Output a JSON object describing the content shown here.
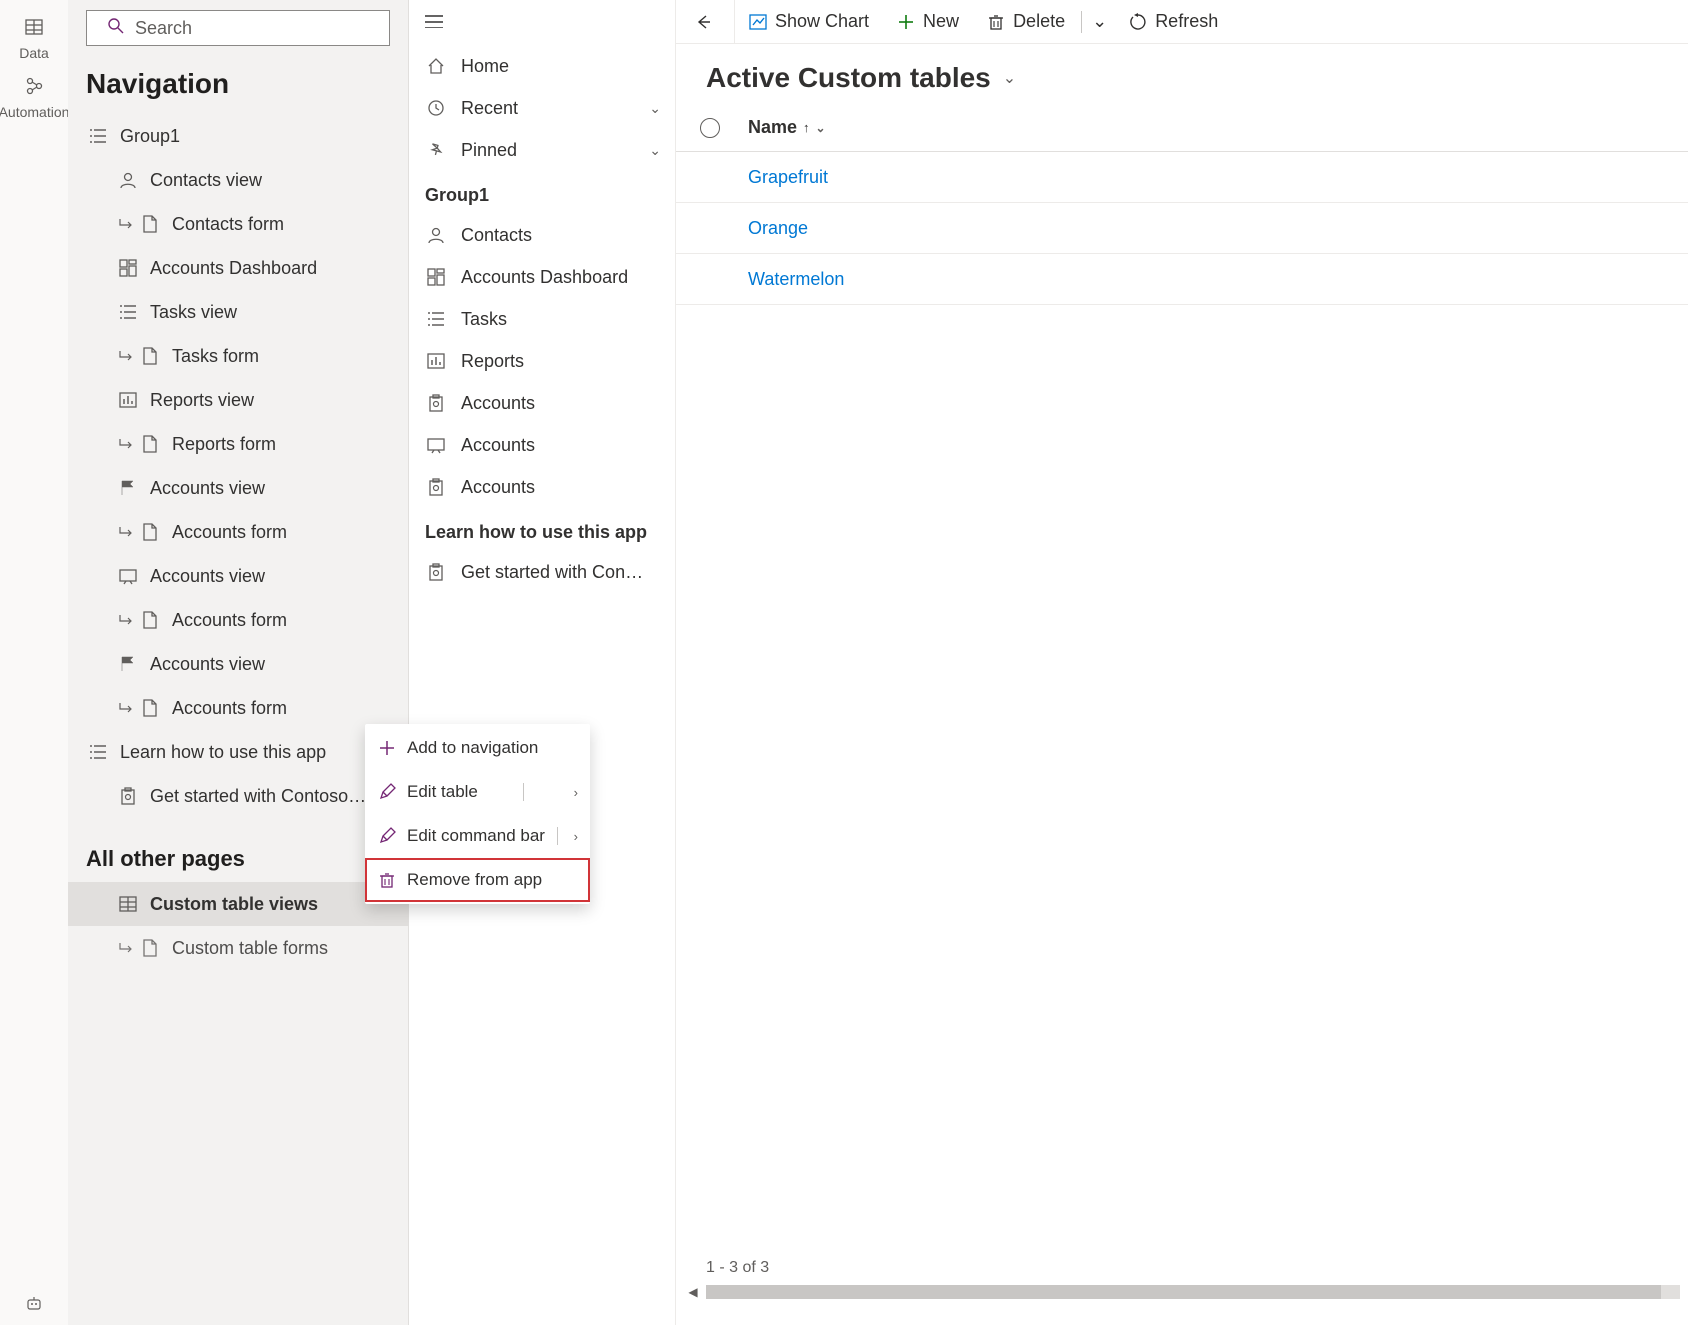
{
  "leftRail": {
    "data": {
      "label": "Data"
    },
    "automation": {
      "label": "Automation"
    }
  },
  "navPanel": {
    "search_placeholder": "Search",
    "title": "Navigation",
    "group_label": "Group1",
    "items": [
      {
        "label": "Contacts view",
        "icon": "person"
      },
      {
        "label": "Contacts form",
        "icon": "form",
        "sub": true
      },
      {
        "label": "Accounts Dashboard",
        "icon": "dashboard"
      },
      {
        "label": "Tasks view",
        "icon": "list"
      },
      {
        "label": "Tasks form",
        "icon": "form",
        "sub": true
      },
      {
        "label": "Reports view",
        "icon": "chart"
      },
      {
        "label": "Reports form",
        "icon": "form",
        "sub": true
      },
      {
        "label": "Accounts view",
        "icon": "flag-red"
      },
      {
        "label": "Accounts form",
        "icon": "form",
        "sub": true
      },
      {
        "label": "Accounts view",
        "icon": "slide"
      },
      {
        "label": "Accounts form",
        "icon": "form",
        "sub": true
      },
      {
        "label": "Accounts view",
        "icon": "flag-red"
      },
      {
        "label": "Accounts form",
        "icon": "form",
        "sub": true
      }
    ],
    "learn_label": "Learn how to use this app",
    "learn_items": [
      {
        "label": "Get started with Contoso…",
        "icon": "clipboard"
      }
    ],
    "other_header": "All other pages",
    "other_items": [
      {
        "label": "Custom table views",
        "icon": "table",
        "selected": true
      },
      {
        "label": "Custom table forms",
        "icon": "form",
        "sub": true
      }
    ]
  },
  "sidebar": {
    "home": "Home",
    "recent": "Recent",
    "pinned": "Pinned",
    "group_header": "Group1",
    "items": [
      {
        "label": "Contacts",
        "icon": "person"
      },
      {
        "label": "Accounts Dashboard",
        "icon": "dashboard"
      },
      {
        "label": "Tasks",
        "icon": "list"
      },
      {
        "label": "Reports",
        "icon": "chart"
      },
      {
        "label": "Accounts",
        "icon": "clipboard"
      },
      {
        "label": "Accounts",
        "icon": "slide"
      },
      {
        "label": "Accounts",
        "icon": "clipboard"
      }
    ],
    "learn_header": "Learn how to use this app",
    "learn_items": [
      {
        "label": "Get started with Con…",
        "icon": "clipboard"
      }
    ]
  },
  "commandBar": {
    "show_chart": "Show Chart",
    "new": "New",
    "delete": "Delete",
    "refresh": "Refresh"
  },
  "main": {
    "view_title": "Active Custom tables",
    "column_name": "Name",
    "rows": [
      "Grapefruit",
      "Orange",
      "Watermelon"
    ],
    "footer": "1 - 3 of 3"
  },
  "contextMenu": {
    "add_to_nav": "Add to navigation",
    "edit_table": "Edit table",
    "edit_cmd_bar": "Edit command bar",
    "remove": "Remove from app"
  }
}
